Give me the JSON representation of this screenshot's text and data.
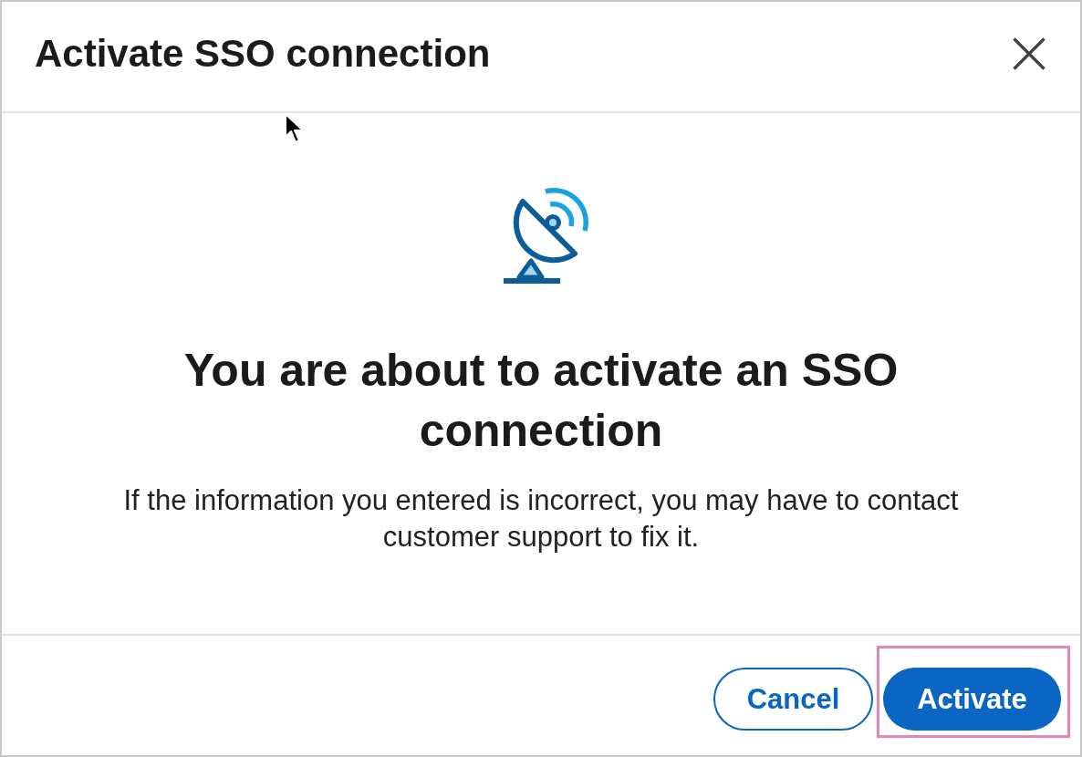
{
  "dialog": {
    "title": "Activate SSO connection"
  },
  "message": {
    "heading": "You are about to activate an SSO connection",
    "body": "If the information you entered is incorrect, you may have to contact customer support to fix it."
  },
  "buttons": [
    {
      "label": "Cancel",
      "kind": "secondary",
      "highlighted": false
    },
    {
      "label": "Activate",
      "kind": "primary",
      "highlighted": true
    }
  ]
}
